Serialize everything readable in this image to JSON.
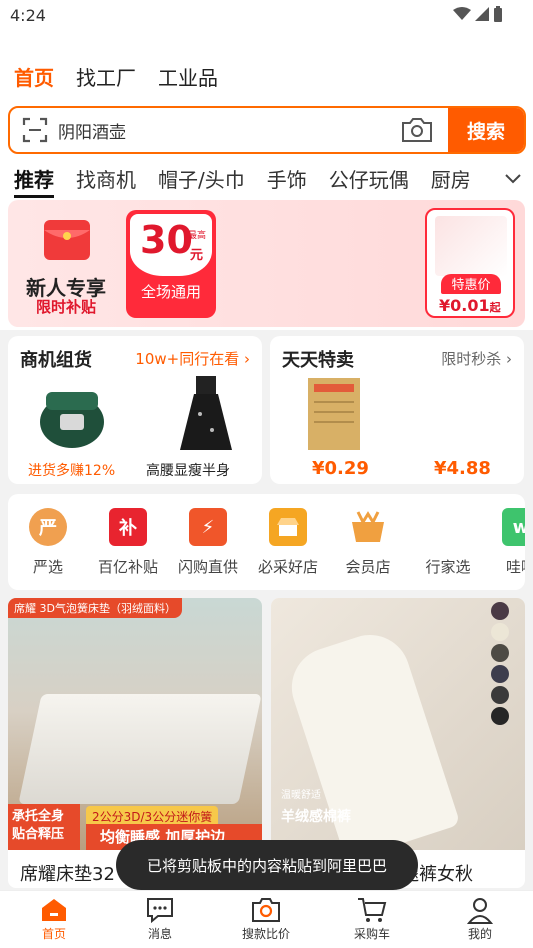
{
  "status_bar": {
    "time": "4:24"
  },
  "top_nav": {
    "items": [
      "首页",
      "找工厂",
      "工业品"
    ],
    "active": 0
  },
  "search": {
    "value": "阴阳酒壶",
    "button": "搜索"
  },
  "categories": {
    "items": [
      "推荐",
      "找商机",
      "帽子/头巾",
      "手饰",
      "公仔玩偶",
      "厨房"
    ],
    "active": 0
  },
  "banner": {
    "title": "新人专享",
    "subtitle": "限时补贴",
    "coupon_amount": "30",
    "coupon_unit_top": "最高",
    "coupon_unit": "元",
    "coupon_label": "全场通用",
    "deal_badge": "特惠价",
    "deal_price": "¥0.01",
    "deal_suffix": "起"
  },
  "card_a": {
    "title": "商机组货",
    "more": "10w+同行在看",
    "products": [
      {
        "caption": "进货多赚12%"
      },
      {
        "caption": "高腰显瘦半身"
      }
    ]
  },
  "card_b": {
    "title": "天天特卖",
    "more": "限时秒杀",
    "products": [
      {
        "price": "¥0.29"
      },
      {
        "price": "¥4.88"
      }
    ]
  },
  "quick_icons": [
    {
      "label": "严选",
      "glyph": "严",
      "color": "#f0a050"
    },
    {
      "label": "百亿补贴",
      "glyph": "补",
      "color": "#e8242f"
    },
    {
      "label": "闪购直供",
      "glyph": "⚡",
      "color": "#f0562a"
    },
    {
      "label": "必采好店",
      "glyph": "",
      "color": "#f5a623"
    },
    {
      "label": "会员店",
      "glyph": "",
      "color": "#f0a040"
    },
    {
      "label": "行家选",
      "glyph": "",
      "color": "#ffffff"
    },
    {
      "label": "哇噢",
      "glyph": "w",
      "color": "#3ec46d"
    }
  ],
  "feed": [
    {
      "tag": "席耀 3D气泡簧床垫（羽绒面料）",
      "promo": "承托全身贴合释压",
      "promo2": "2公分3D/3公分迷你簧",
      "promo3": "均衡睡感 加厚护边",
      "name": "席耀床垫32"
    },
    {
      "small_caption": "温暖舒适",
      "caption": "羊绒感棉裤",
      "name": "阔腿裤女秋",
      "swatches": [
        "#4a3a45",
        "#ece6d6",
        "#4d4a44",
        "#3d3d4d",
        "#3a3a3a",
        "#262626"
      ]
    }
  ],
  "toast": "已将剪贴板中的内容粘贴到阿里巴巴",
  "tabbar": {
    "items": [
      "首页",
      "消息",
      "搜款比价",
      "采购车",
      "我的"
    ],
    "active": 0
  }
}
